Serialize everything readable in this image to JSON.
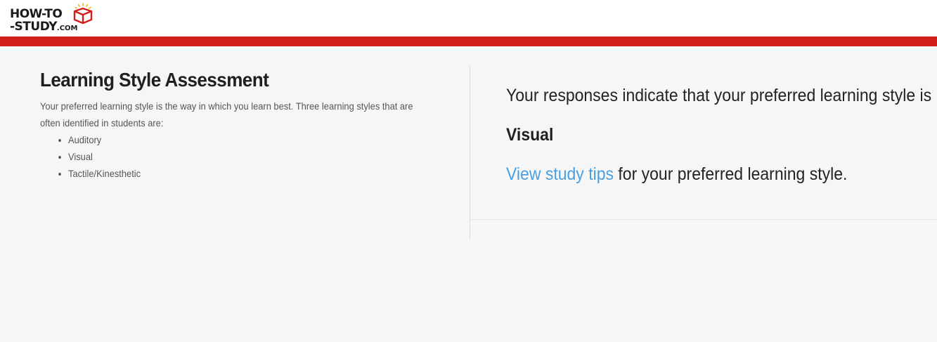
{
  "site": {
    "logo_line1": "HOW-TO",
    "logo_line2": "-STUDY",
    "logo_com": ".COM",
    "logo_icon": "book-box-icon",
    "accent_color": "#d21f1c",
    "link_color": "#4a9fe0"
  },
  "assessment": {
    "title": "Learning Style Assessment",
    "intro": "Your preferred learning style is the way in which you learn best. Three learning styles that are often identified in students are:",
    "styles": [
      "Auditory",
      "Visual",
      "Tactile/Kinesthetic"
    ]
  },
  "result": {
    "statement": "Your responses indicate that your preferred learning style is",
    "style": "Visual",
    "tips_link": "View study tips",
    "tips_suffix": " for your preferred learning style."
  }
}
